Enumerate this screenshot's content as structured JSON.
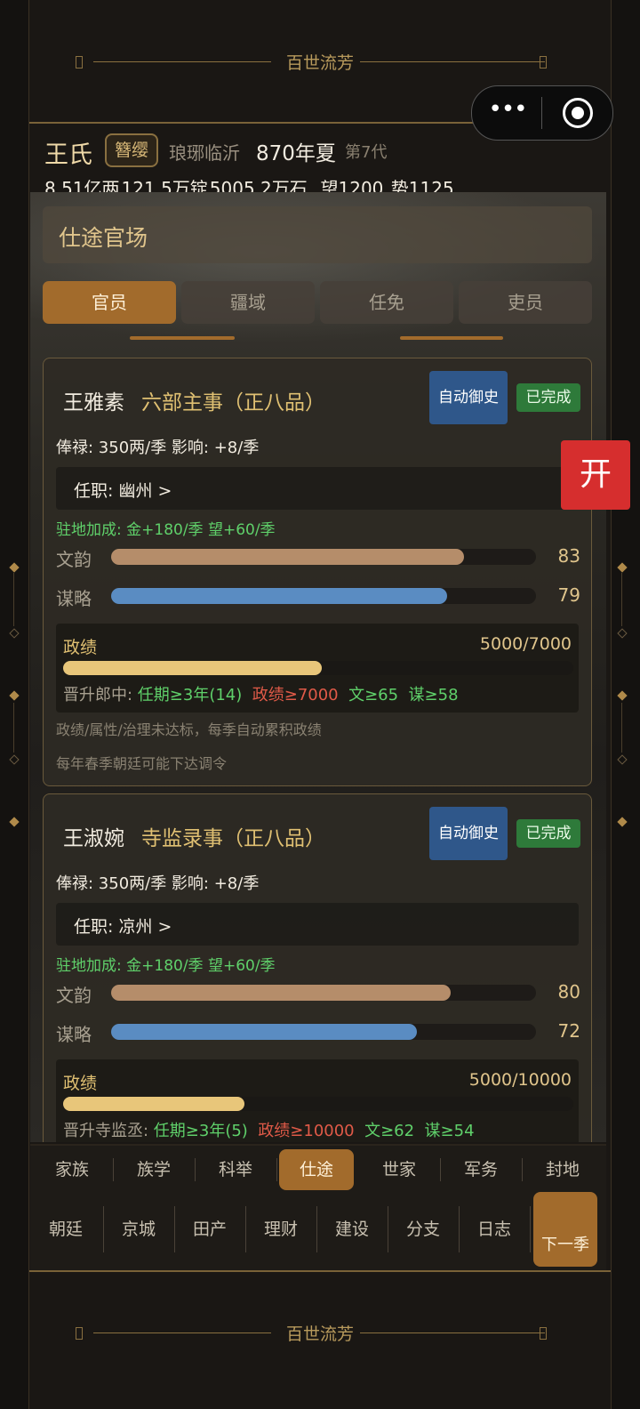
{
  "banner": {
    "title": "百世流芳"
  },
  "header": {
    "family": "王氏",
    "rank_badge": "簪缨",
    "origin": "琅琊临沂",
    "date": "870年夏",
    "generation": "第7代",
    "silver": "8.51亿两",
    "gold": "121.5万锭",
    "grain": "5005.2万石",
    "prestige": "望1200",
    "power": "势1125"
  },
  "section": {
    "title": "仕途官场"
  },
  "tabs": [
    {
      "label": "官员",
      "active": true
    },
    {
      "label": "疆域",
      "active": false
    },
    {
      "label": "任免",
      "active": false
    },
    {
      "label": "吏员",
      "active": false
    }
  ],
  "open_button": "开",
  "officials": [
    {
      "name": "王雅素",
      "post": "六部主事（正八品）",
      "auto_button": "自动御史",
      "status": "已完成",
      "pay": "俸禄: 350两/季   影响: +8/季",
      "station": "任职: 幽州  >",
      "bonus": "驻地加成: 金+180/季  望+60/季",
      "stats": [
        {
          "label": "文韵",
          "value": 83,
          "max": 100,
          "color": "#b58d6a"
        },
        {
          "label": "谋略",
          "value": 79,
          "max": 100,
          "color": "#5a8cc2"
        }
      ],
      "merit": {
        "label": "政绩",
        "value": 5000,
        "max": 7000,
        "text": "5000/7000"
      },
      "promotion": {
        "prefix": "晋升郎中: ",
        "term": "任期≥3年(14)",
        "merit_req": "政绩≥7000",
        "wen_req": "文≥65",
        "mou_req": "谋≥58"
      },
      "notes": [
        "政绩/属性/治理未达标，每季自动累积政绩",
        "每年春季朝廷可能下达调令"
      ]
    },
    {
      "name": "王淑婉",
      "post": "寺监录事（正八品）",
      "auto_button": "自动御史",
      "status": "已完成",
      "pay": "俸禄: 350两/季   影响: +8/季",
      "station": "任职: 凉州  >",
      "bonus": "驻地加成: 金+180/季  望+60/季",
      "stats": [
        {
          "label": "文韵",
          "value": 80,
          "max": 100,
          "color": "#b58d6a"
        },
        {
          "label": "谋略",
          "value": 72,
          "max": 100,
          "color": "#5a8cc2"
        }
      ],
      "merit": {
        "label": "政绩",
        "value": 5000,
        "max": 10000,
        "text": "5000/10000"
      },
      "promotion": {
        "prefix": "晋升寺监丞: ",
        "term": "任期≥3年(5)",
        "merit_req": "政绩≥10000",
        "wen_req": "文≥62",
        "mou_req": "谋≥54"
      },
      "notes": []
    }
  ],
  "nav_row1": [
    "家族",
    "族学",
    "科举",
    "仕途",
    "世家",
    "军务",
    "封地"
  ],
  "nav_row1_active": "仕途",
  "nav_row2": [
    "朝廷",
    "京城",
    "田产",
    "理财",
    "建设",
    "分支",
    "日志"
  ],
  "next_button": "下一季"
}
